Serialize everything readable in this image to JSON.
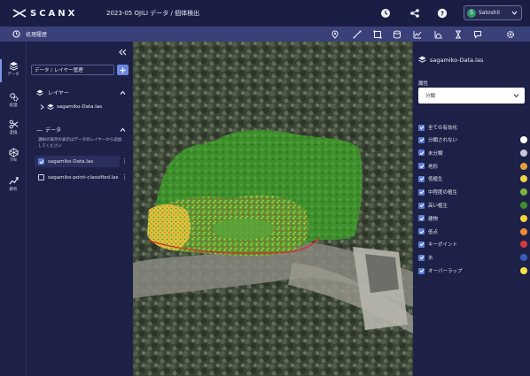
{
  "app": {
    "logo_text": "SCANX",
    "title": "2023-05 OJILI データ / 個体検出"
  },
  "header": {
    "icons": [
      "time-icon",
      "share-icon",
      "help-icon"
    ],
    "user": {
      "initial": "S",
      "name": "SatoshiI"
    }
  },
  "toolbar": {
    "label": "処理履歴",
    "tools": [
      "location-pin-icon",
      "line-measure-icon",
      "area-select-icon",
      "volume-icon",
      "elevation-profile-icon",
      "cross-section-icon",
      "height-icon",
      "annotation-icon",
      "settings-icon"
    ]
  },
  "rail": [
    {
      "label": "データ",
      "icon": "layers-icon"
    },
    {
      "label": "処理",
      "icon": "process-gear-icon"
    },
    {
      "label": "変換",
      "icon": "convert-icon"
    },
    {
      "label": "TIN",
      "icon": "tin-icon"
    },
    {
      "label": "解析",
      "icon": "analysis-icon"
    }
  ],
  "left_panel": {
    "header": "データ / レイヤー管理",
    "layers_section": "レイヤー",
    "layer_item": "sagamiko-Data.las",
    "data_section": "データ",
    "data_help": "選択の既存の表示はデータのレイヤーから追加してください",
    "files": [
      {
        "name": "sagamiko-Data.las",
        "checked": true
      },
      {
        "name": "sagamiko-point-classified.las",
        "checked": false
      }
    ]
  },
  "right_panel": {
    "file_title": "sagamiko-Data.las",
    "attribute_label": "属性",
    "attribute_value": "分類",
    "select_all": "全ての有効化",
    "legend": [
      {
        "label": "分類されない",
        "color": "#ffffff"
      },
      {
        "label": "未分類",
        "color": "#c8c8d8"
      },
      {
        "label": "地形",
        "color": "#e2a23a"
      },
      {
        "label": "低植生",
        "color": "#f0d24a"
      },
      {
        "label": "中程度の植生",
        "color": "#7cb342"
      },
      {
        "label": "高い植生",
        "color": "#3e8e2e"
      },
      {
        "label": "建物",
        "color": "#f3d23a"
      },
      {
        "label": "低点",
        "color": "#ef8a3a"
      },
      {
        "label": "キーポイント",
        "color": "#d63a3a"
      },
      {
        "label": "水",
        "color": "#3a5bb8"
      },
      {
        "label": "オーバーラップ",
        "color": "#f5e04a"
      }
    ]
  }
}
